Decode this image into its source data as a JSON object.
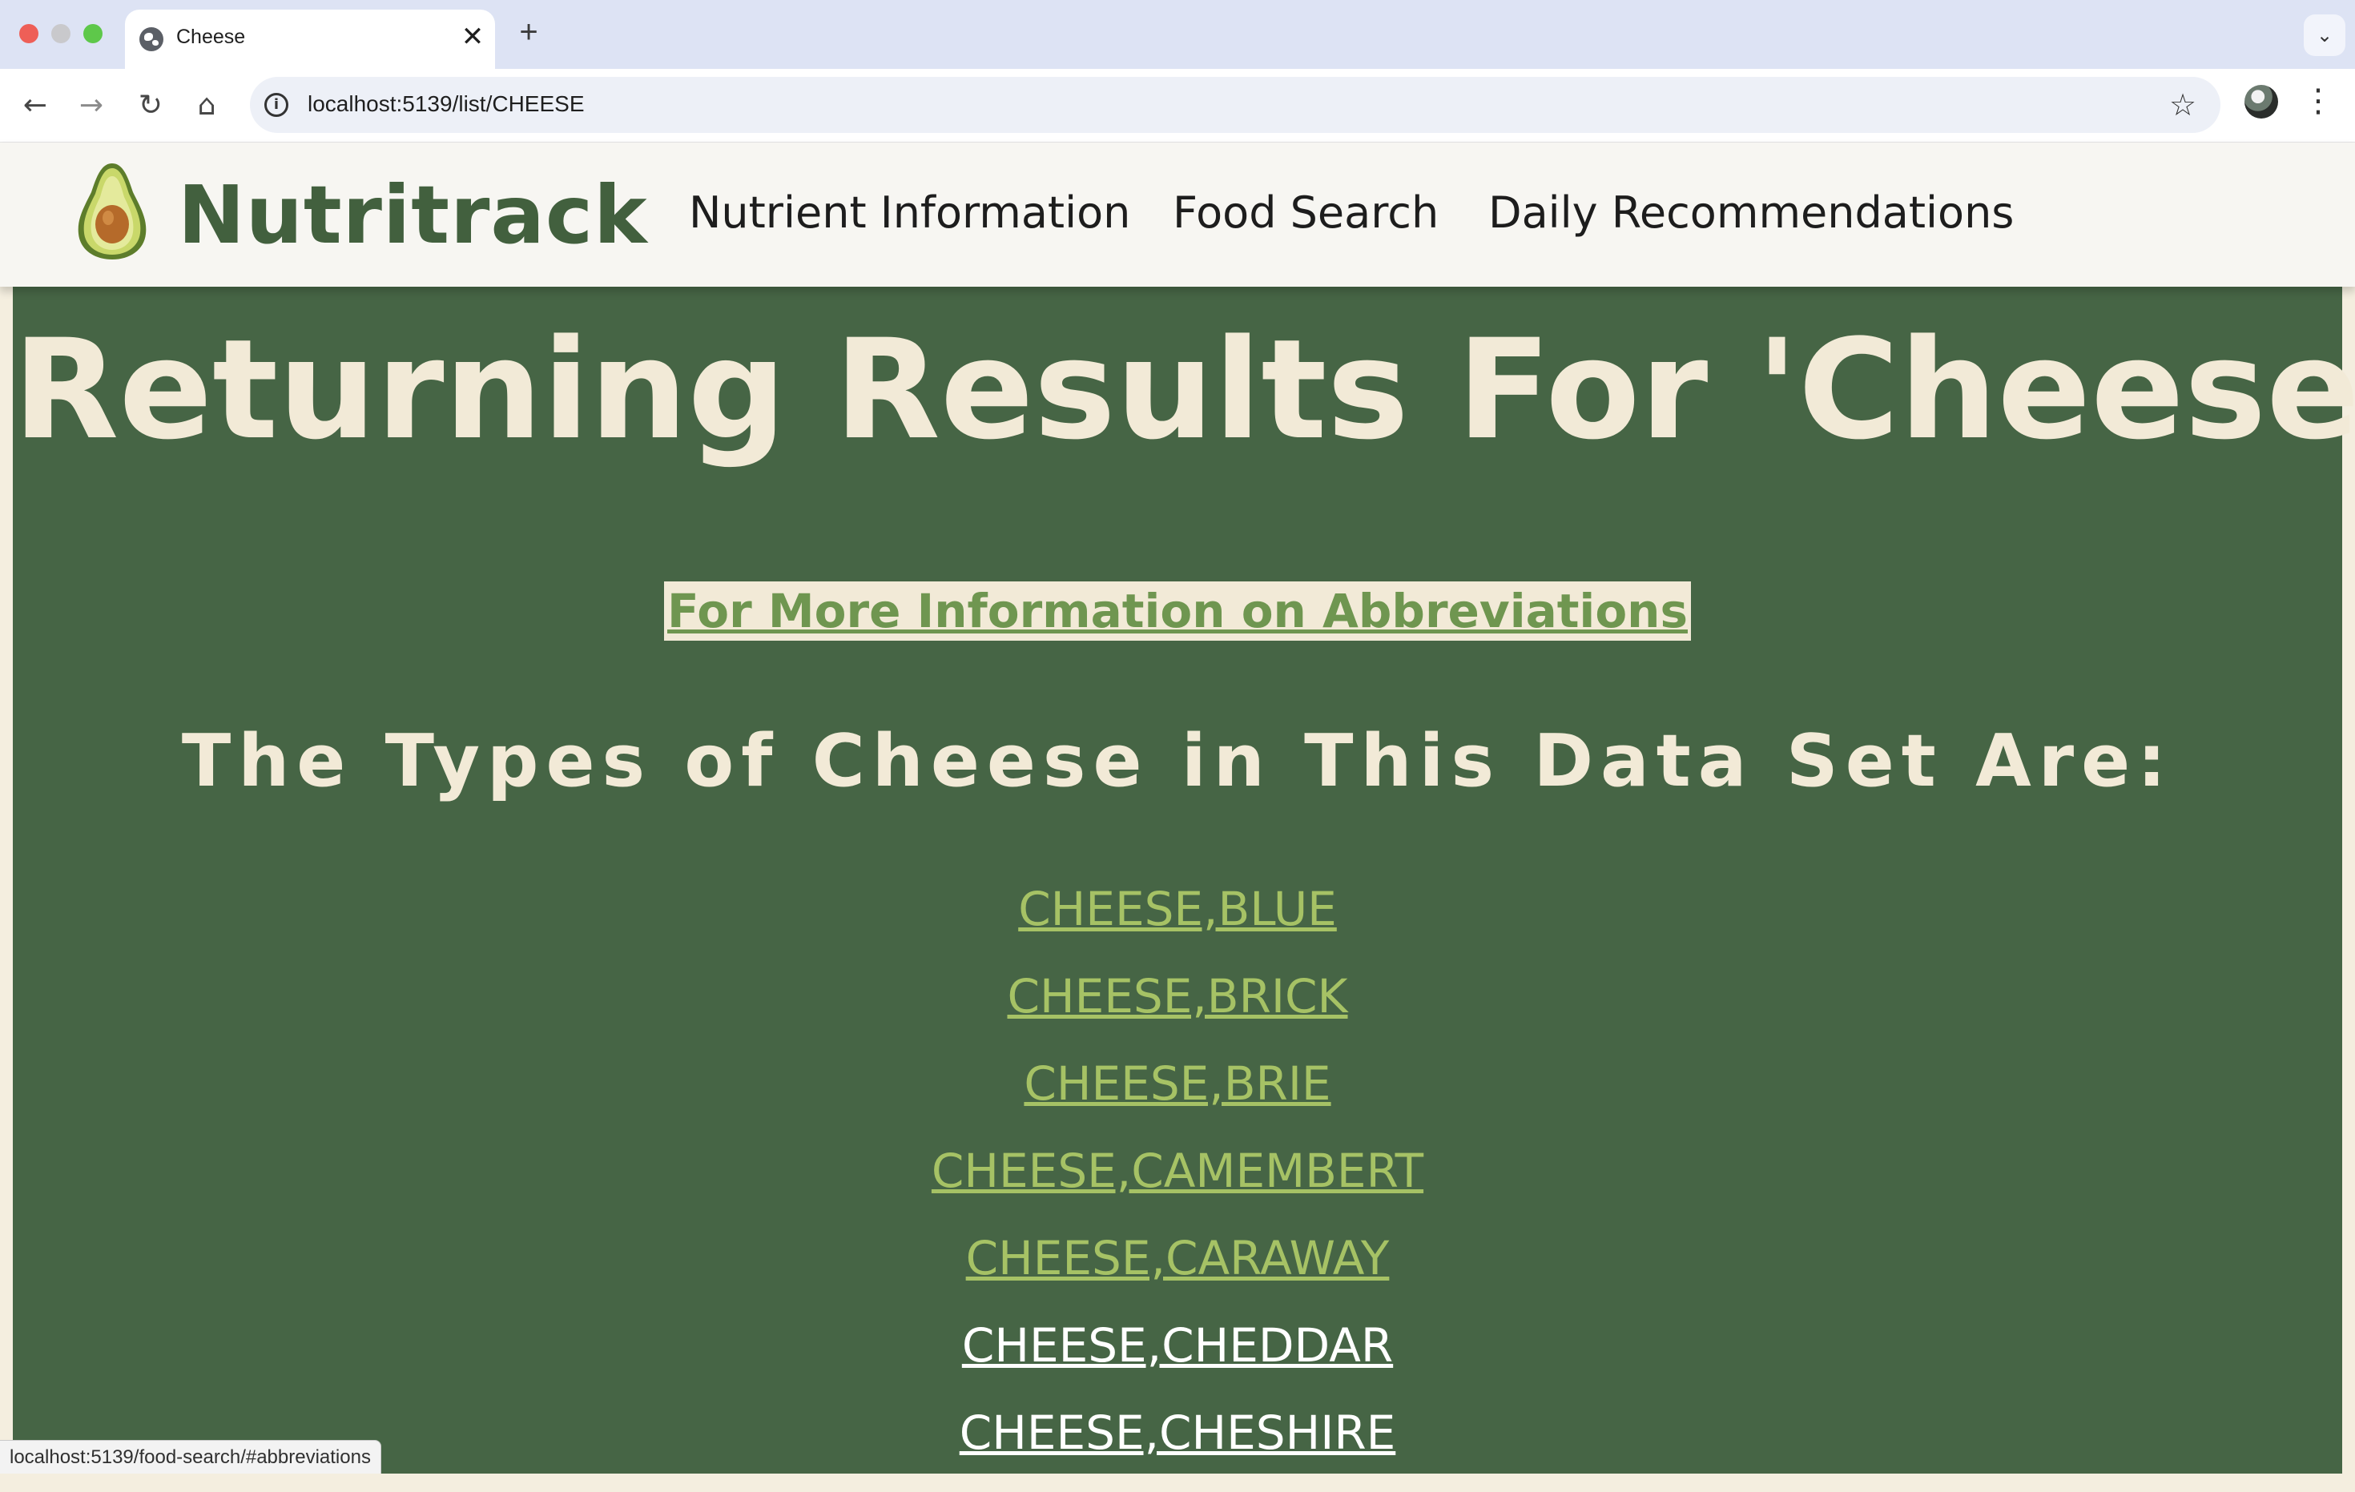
{
  "browser": {
    "tab_title": "Cheese",
    "tab_close": "✕",
    "new_tab": "+",
    "tab_menu": "⌄",
    "url": "localhost:5139/list/CHEESE",
    "status_url": "localhost:5139/food-search/#abbreviations",
    "icons": {
      "back": "←",
      "forward": "→",
      "reload": "↻",
      "home": "⌂",
      "info": "i",
      "star": "☆",
      "kebab": "⋮"
    }
  },
  "header": {
    "brand": "Nutritrack",
    "nav": [
      {
        "label": "Nutrient Information"
      },
      {
        "label": "Food Search"
      },
      {
        "label": "Daily Recommendations"
      }
    ]
  },
  "main": {
    "title": "Returning Results For 'Cheese':",
    "abbreviations_link": "For More Information on Abbreviations",
    "subtitle": "The Types of Cheese in This Data Set Are:",
    "items": [
      "CHEESE,BLUE",
      "CHEESE,BRICK",
      "CHEESE,BRIE",
      "CHEESE,CAMEMBERT",
      "CHEESE,CARAWAY",
      "CHEESE,CHEDDAR",
      "CHEESE,CHESHIRE"
    ]
  },
  "colors": {
    "brand_green": "#42603e",
    "main_bg": "#466545",
    "cream": "#f2ead7",
    "link_green": "#a6c265",
    "abbr_link": "#6f9650"
  }
}
